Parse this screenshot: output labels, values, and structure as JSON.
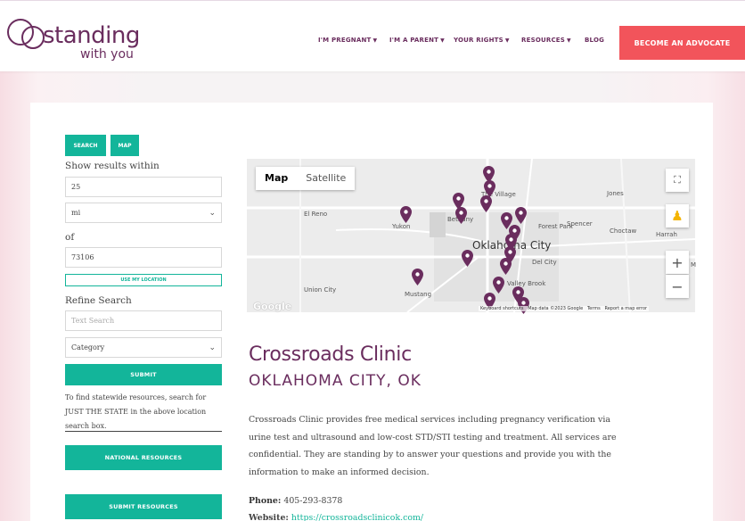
{
  "header": {
    "logo": {
      "line1": "standing",
      "line2": "with you"
    },
    "nav": [
      {
        "label": "I'M PREGNANT",
        "dropdown": true
      },
      {
        "label": "I'M A PARENT",
        "dropdown": true
      },
      {
        "label": "YOUR RIGHTS",
        "dropdown": true
      },
      {
        "label": "RESOURCES",
        "dropdown": true
      },
      {
        "label": "BLOG",
        "dropdown": false
      }
    ],
    "cta_label": "BECOME AN ADVOCATE"
  },
  "sidebar": {
    "tab_search": "SEARCH",
    "tab_map": "MAP",
    "within_label": "Show results within",
    "radius_value": "25",
    "unit_value": "mi",
    "of_label": "of",
    "zip_value": "73106",
    "use_location_label": "USE MY LOCATION",
    "refine_label": "Refine Search",
    "text_search_placeholder": "Text Search",
    "category_value": "Category",
    "submit_label": "SUBMIT",
    "note": "To find statewide resources, search for JUST THE STATE in the above location search box.",
    "national_label": "NATIONAL RESOURCES",
    "submit_resources_label": "SUBMIT RESOURCES"
  },
  "map": {
    "type_map": "Map",
    "type_satellite": "Satellite",
    "place_labels": [
      "The Village",
      "Jones",
      "El Reno",
      "Yukon",
      "Bethany",
      "Forest Park",
      "Spencer",
      "Choctaw",
      "Harrah",
      "Oklahoma City",
      "Del City",
      "Valley Brook",
      "Union City",
      "Mustang",
      "M"
    ],
    "attribution": [
      "Keyboard shortcuts",
      "Map data ©2023 Google",
      "Terms",
      "Report a map error"
    ],
    "google_logo": "Google",
    "pin_color": "#6a2d5e"
  },
  "clinic": {
    "name": "Crossroads Clinic",
    "location": "OKLAHOMA CITY, OK",
    "description": "Crossroads Clinic provides free medical services including pregnancy verification via urine test and ultrasound and low-cost STD/STI testing and treatment. All services are confidential. They are standing by to answer your questions and provide you with the information to make an informed decision.",
    "phone_label": "Phone:",
    "phone": "405-293-8378",
    "website_label": "Website:",
    "website": "https://crossroadsclinicok.com/"
  },
  "colors": {
    "brand": "#6a2d5e",
    "accent": "#13b59a",
    "cta": "#f2545b"
  }
}
